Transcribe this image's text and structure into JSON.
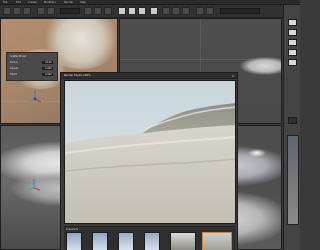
{
  "menubar": {
    "items": [
      "File",
      "Edit",
      "Create",
      "Modifiers",
      "Render",
      "Help"
    ]
  },
  "toolbar": {
    "search_placeholder": ""
  },
  "scene_popup": {
    "title": "Scatter Brush",
    "rows": [
      {
        "label": "Radius",
        "value": "10.00"
      },
      {
        "label": "Density",
        "value": "1.000"
      },
      {
        "label": "Falloff",
        "value": "0.500"
      }
    ]
  },
  "render_window": {
    "title": "Render Studio   100%",
    "close_icon": "close-icon",
    "thumb_strip_label": "Snapshots"
  },
  "icons": {
    "menu": "hamburger-icon",
    "close": "close-icon",
    "gizmo": "axis-gizmo-icon"
  },
  "colors": {
    "accent": "#d0823a",
    "dark_ui": "#2b2b2b",
    "panel": "#3c3c3c"
  }
}
